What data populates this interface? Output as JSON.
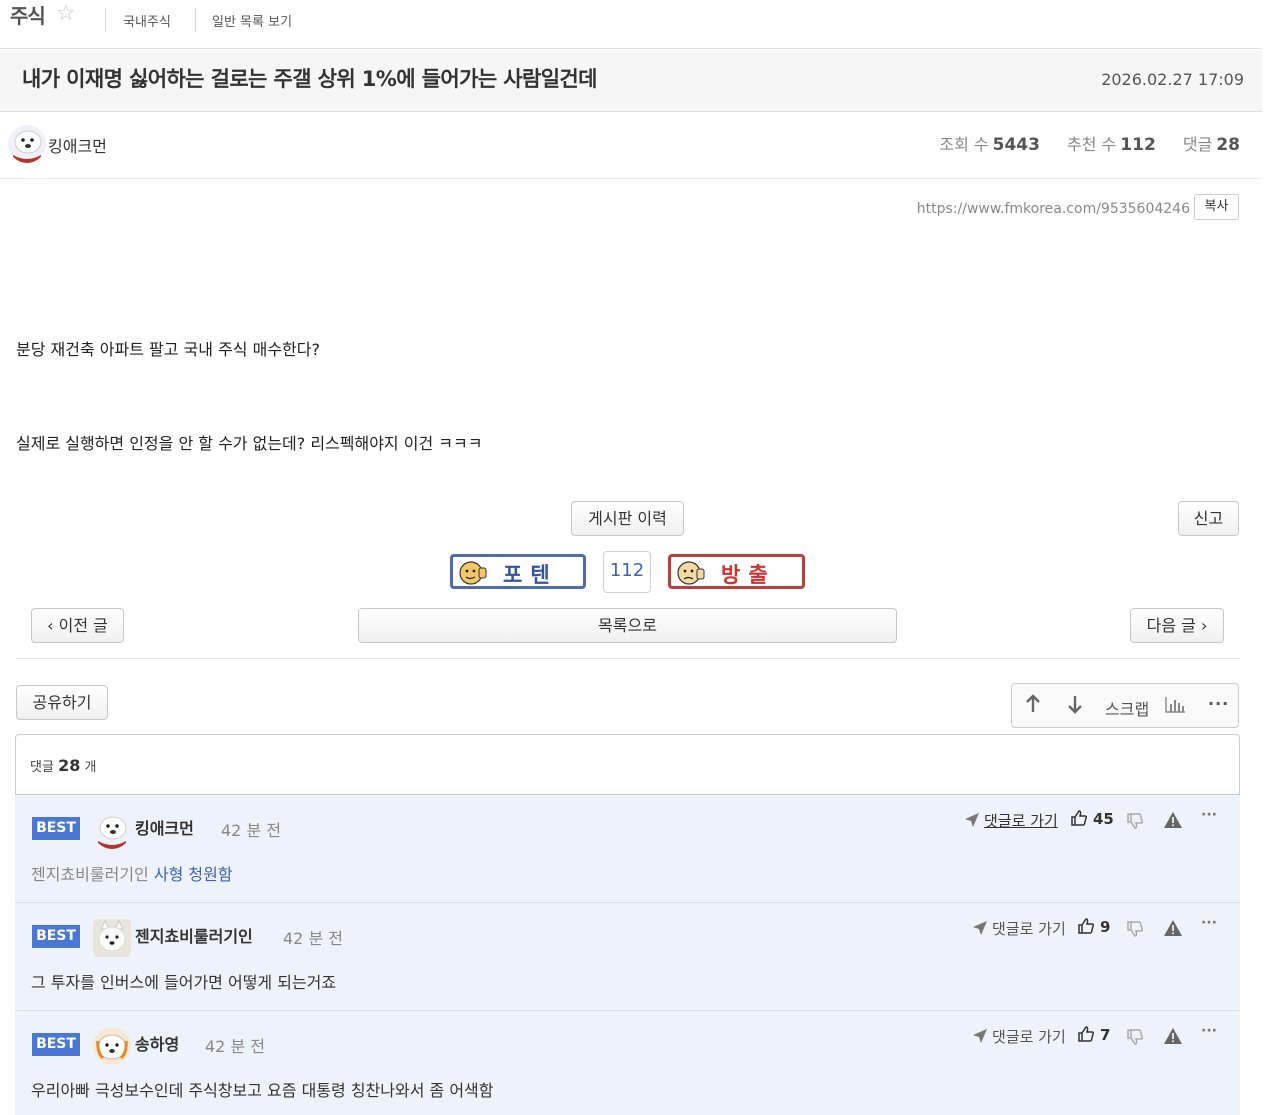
{
  "board": {
    "name": "주식",
    "links": [
      "국내주식",
      "일반 목록 보기"
    ]
  },
  "post": {
    "title": "내가 이재명 싫어하는 걸로는 주갤 상위 1%에 들어가는 사람일건데",
    "date": "2026.02.27 17:09",
    "author": "킹애크먼",
    "views_label": "조회 수",
    "views": "5443",
    "recs_label": "추천 수",
    "recs": "112",
    "comments_label": "댓글",
    "comments": "28",
    "url": "https://www.fmkorea.com/9535604246",
    "copy_label": "복사",
    "body": [
      "분당 재건축 아파트 팔고 국내 주식 매수한다?",
      "실제로 실행하면 인정을 안 할 수가 없는데? 리스펙해야지 이건 ㅋㅋㅋ"
    ]
  },
  "actions": {
    "history": "게시판 이력",
    "report": "신고",
    "upvote": "포텐",
    "vote_count": "112",
    "downvote": "방출",
    "prev": "이전 글",
    "list": "목록으로",
    "next": "다음 글",
    "share": "공유하기",
    "scrap": "스크랩"
  },
  "comment_section": {
    "label_prefix": "댓글",
    "count": "28",
    "label_suffix": "개"
  },
  "comments": [
    {
      "badge": "BEST",
      "author": "킹애크먼",
      "time": "42 분 전",
      "reply_label": "댓글로 가기",
      "likes": "45",
      "text_muted": "젠지쵸비룰러기인",
      "text_link": "사형 청원함"
    },
    {
      "badge": "BEST",
      "author": "젠지쵸비룰러기인",
      "time": "42 분 전",
      "reply_label": "댓글로 가기",
      "likes": "9",
      "text": "그 투자를 인버스에 들어가면 어떻게 되는거죠"
    },
    {
      "badge": "BEST",
      "author": "송하영",
      "time": "42 분 전",
      "reply_label": "댓글로 가기",
      "likes": "7",
      "text": "우리아빠 극성보수인데 주식창보고 요즘 대통령 칭찬나와서 좀 어색함"
    }
  ],
  "icons": [
    "star-icon",
    "arrow-up-icon",
    "arrow-down-icon",
    "chart-icon",
    "more-icon",
    "send-icon",
    "thumbs-up-icon",
    "thumbs-down-icon",
    "warning-icon"
  ],
  "colors": {
    "best_badge": "#4a77d4",
    "upvote": "#3253a6",
    "downvote": "#d03030",
    "comment_bg": "#eef2fa"
  }
}
